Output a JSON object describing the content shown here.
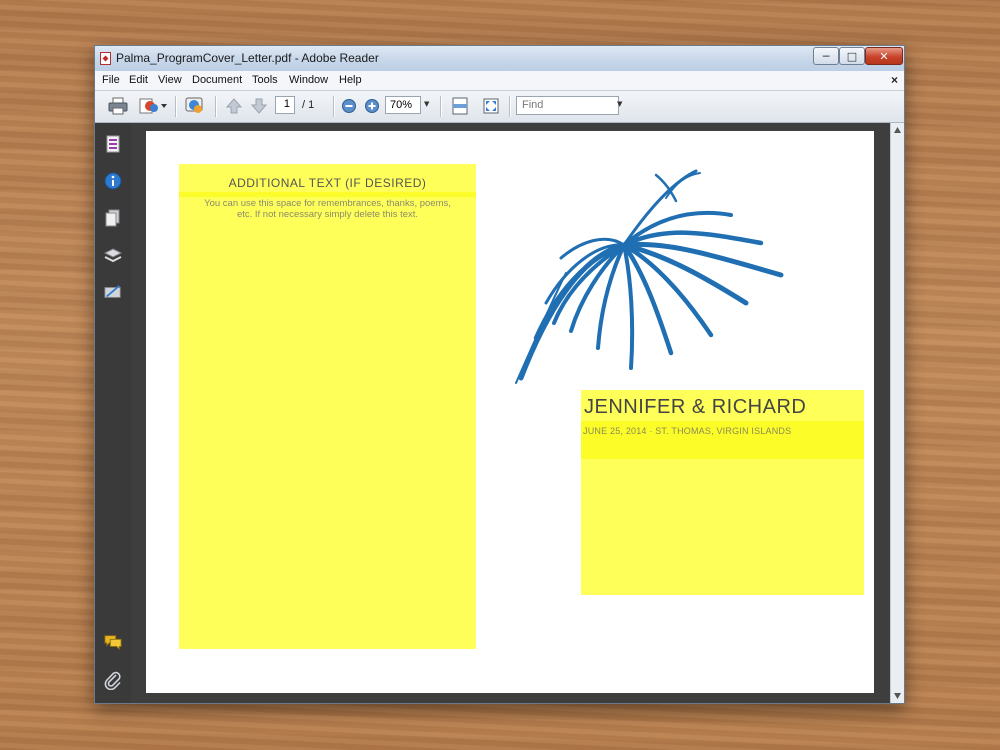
{
  "window": {
    "title": "Palma_ProgramCover_Letter.pdf - Adobe Reader",
    "min_glyph": "─",
    "max_glyph": "□",
    "close_glyph": "✕"
  },
  "menu": {
    "items": [
      "File",
      "Edit",
      "View",
      "Document",
      "Tools",
      "Window",
      "Help"
    ],
    "doc_close": "×"
  },
  "toolbar": {
    "page_current": "1",
    "page_total": "/ 1",
    "zoom": "70%",
    "find_placeholder": "Find",
    "dropdown_glyph": "▼"
  },
  "document": {
    "additional_title": "ADDITIONAL TEXT (IF DESIRED)",
    "additional_body": "You can use this space for remembrances, thanks, poems, etc. If not necessary simply delete this text.",
    "names": "JENNIFER & RICHARD",
    "date_location": "JUNE 25, 2014 · ST. THOMAS, VIRGIN ISLANDS"
  },
  "colors": {
    "field_yellow": "#ffff5a",
    "palm_blue": "#1f6fb2",
    "sidebar": "#3a3a3a"
  },
  "icons": [
    "pdf-app-icon",
    "print-icon",
    "create-icon",
    "collaborate-icon",
    "previous-page-icon",
    "next-page-icon",
    "zoom-out-icon",
    "zoom-in-icon",
    "fit-width-icon",
    "full-screen-icon",
    "pages-icon",
    "info-icon",
    "attachments-doc-icon",
    "layers-icon",
    "signatures-icon",
    "comments-icon",
    "paperclip-icon"
  ]
}
